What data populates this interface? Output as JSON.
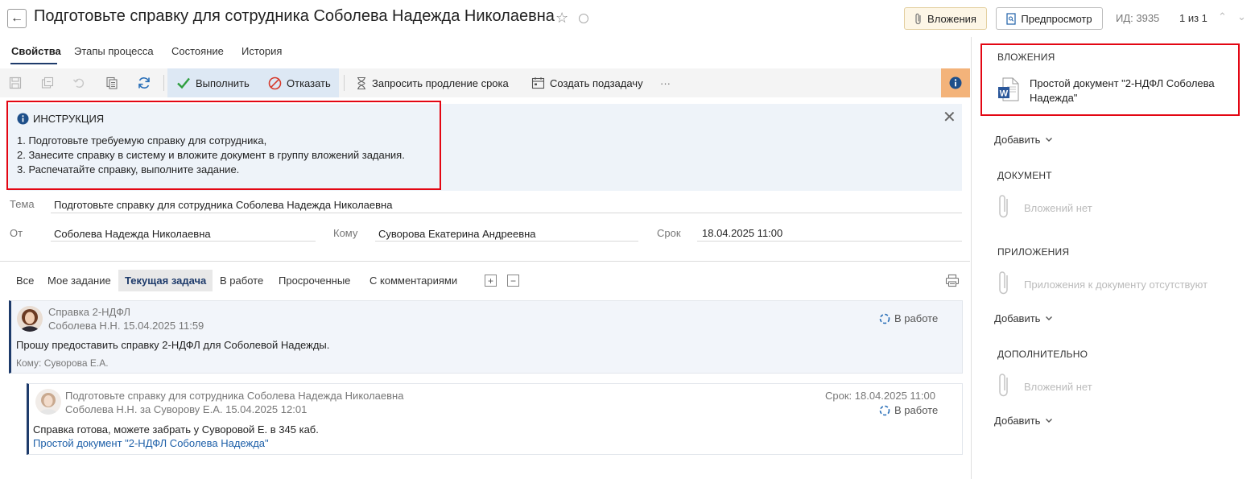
{
  "header": {
    "back_icon": "arrow-left-icon",
    "title": "Подготовьте справку для сотрудника Соболева Надежда Николаевна",
    "attachments_button": "Вложения",
    "preview_button": "Предпросмотр",
    "id_label": "ИД: 3935",
    "page_count": "1 из 1"
  },
  "tabs": [
    "Свойства",
    "Этапы процесса",
    "Состояние",
    "История"
  ],
  "toolbar": {
    "complete": "Выполнить",
    "refuse": "Отказать",
    "request_extension": "Запросить продление срока",
    "create_subtask": "Создать подзадачу",
    "more": "···"
  },
  "instruction": {
    "title": "ИНСТРУКЦИЯ",
    "lines": [
      "1. Подготовьте требуемую справку для сотрудника,",
      "2. Занесите справку в систему и вложите документ в группу вложений задания.",
      "3. Распечатайте справку, выполните задание."
    ]
  },
  "fields": {
    "subject_label": "Тема",
    "subject_value": "Подготовьте справку для сотрудника Соболева Надежда Николаевна",
    "from_label": "От",
    "from_value": "Соболева Надежда Николаевна",
    "to_label": "Кому",
    "to_value": "Суворова Екатерина Андреевна",
    "deadline_label": "Срок",
    "deadline_value": "18.04.2025 11:00"
  },
  "filters": [
    "Все",
    "Мое задание",
    "Текущая задача",
    "В работе",
    "Просроченные",
    "С комментариями"
  ],
  "comments": [
    {
      "title": "Справка 2-НДФЛ",
      "author_date": "Соболева Н.Н.  15.04.2025 11:59",
      "status": "В работе",
      "text": "Прошу предоставить справку 2-НДФЛ для Соболевой Надежды.",
      "recipient": "Кому: Суворова Е.А."
    },
    {
      "title": "Подготовьте справку для сотрудника Соболева Надежда Николаевна",
      "author_date": "Соболева Н.Н. за Суворову Е.А.  15.04.2025 12:01",
      "deadline": "Срок: 18.04.2025 11:00",
      "status": "В работе",
      "text": "Справка готова, можете забрать у Суворовой Е. в 345 каб.",
      "link": "Простой документ \"2-НДФЛ Соболева Надежда\""
    }
  ],
  "right_panel": {
    "attachments_heading": "ВЛОЖЕНИЯ",
    "attachment_name": "Простой документ \"2-НДФЛ Соболева Надежда\"",
    "add_label": "Добавить",
    "document_heading": "ДОКУМЕНТ",
    "document_empty": "Вложений нет",
    "appendix_heading": "ПРИЛОЖЕНИЯ",
    "appendix_empty": "Приложения к документу отсутствуют",
    "additional_heading": "ДОПОЛНИТЕЛЬНО",
    "additional_empty": "Вложений нет"
  },
  "colors": {
    "accent": "#1e3b6b",
    "highlight_red": "#e30613",
    "info_orange": "#f3b37a",
    "link_blue": "#1d5fa8"
  }
}
